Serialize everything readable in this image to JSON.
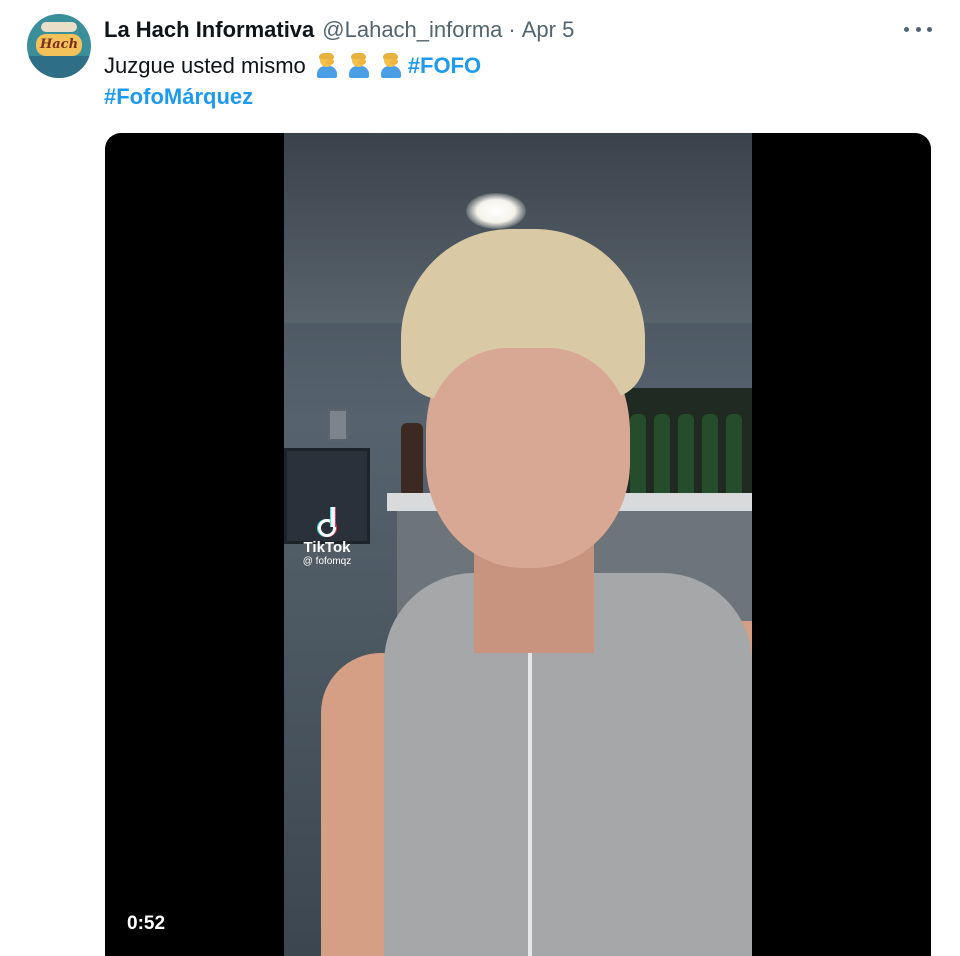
{
  "tweet": {
    "display_name": "La Hach Informativa",
    "handle": "@Lahach_informa",
    "separator": "·",
    "date": "Apr 5",
    "text": "Juzgue usted mismo",
    "emoji": [
      "man-facepalming",
      "man-facepalming",
      "man-facepalming"
    ],
    "hashtags": [
      "#FOFO",
      "#FofoMárquez"
    ],
    "avatar_text": "Hach"
  },
  "video": {
    "duration": "0:52",
    "watermark_brand": "TikTok",
    "watermark_user": "@ fofomqz"
  },
  "colors": {
    "hashtag": "#1d9bf0",
    "secondary_text": "#536471",
    "primary_text": "#0f1419"
  }
}
